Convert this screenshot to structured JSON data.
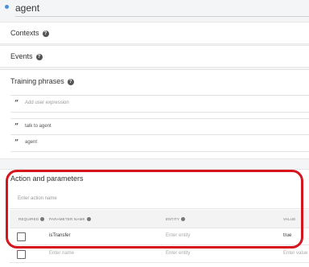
{
  "intent": {
    "name": "agent"
  },
  "sections": {
    "contexts": {
      "title": "Contexts"
    },
    "events": {
      "title": "Events"
    },
    "training_phrases": {
      "title": "Training phrases",
      "input_placeholder": "Add user expression",
      "phrases": [
        "talk to agent",
        "agent"
      ]
    },
    "actions": {
      "title": "Action and parameters",
      "action_placeholder": "Enter action name",
      "columns": {
        "required": "REQUIRED",
        "parameter_name": "PARAMETER NAME",
        "entity": "ENTITY",
        "value": "VALUE"
      },
      "rows": [
        {
          "parameter_name": "isTransfer",
          "entity_placeholder": "Enter entity",
          "value": "true"
        }
      ],
      "new_row": {
        "name_placeholder": "Enter name",
        "entity_placeholder": "Enter entity",
        "value_placeholder": "Enter value"
      }
    }
  },
  "colors": {
    "accent_dot": "#4d90d9",
    "highlight": "#d7141e"
  }
}
